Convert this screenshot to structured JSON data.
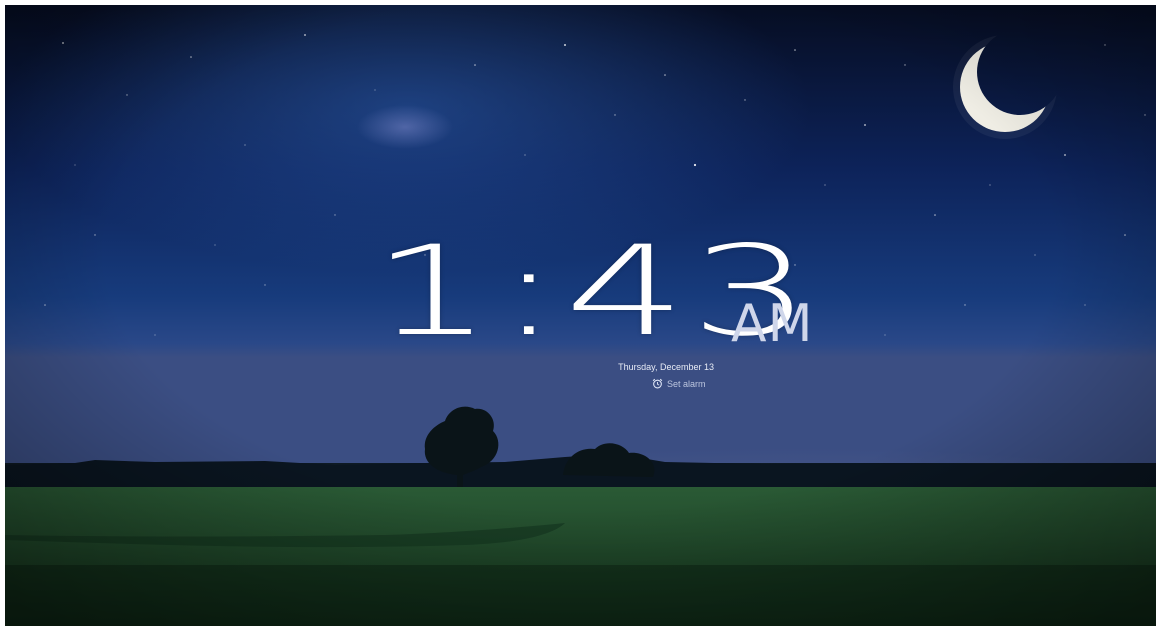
{
  "clock": {
    "time": "1:43",
    "meridiem": "AM",
    "date": "Thursday, December 13"
  },
  "alarm": {
    "label": "Set alarm",
    "icon": "alarm-clock-icon"
  },
  "wallpaper": {
    "sky_top": "#071027",
    "sky_mid": "#163a7a",
    "horizon": "#3a4f86",
    "field": "#1f4a2c",
    "moon": "#e9e6dd"
  }
}
